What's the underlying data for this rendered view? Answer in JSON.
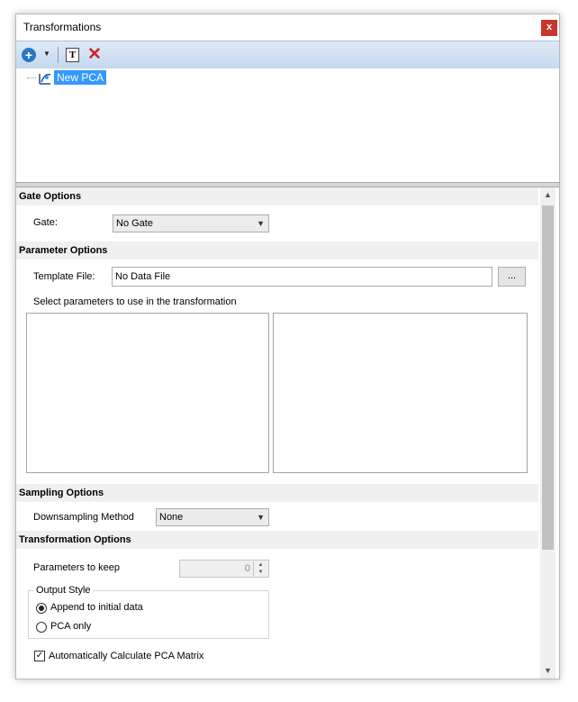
{
  "window": {
    "title": "Transformations",
    "close_label": "x"
  },
  "toolbar": {
    "add_icon": "plus-circle-icon",
    "text_icon_label": "T",
    "delete_icon": "red-x-icon"
  },
  "tree": {
    "node_label": "New PCA",
    "node_icon": "pca-icon"
  },
  "gate_options": {
    "header": "Gate Options",
    "gate_label": "Gate:",
    "gate_value": "No Gate"
  },
  "parameter_options": {
    "header": "Parameter Options",
    "template_label": "Template File:",
    "template_value": "No Data File",
    "browse_label": "...",
    "select_text": "Select parameters to use in the transformation"
  },
  "sampling_options": {
    "header": "Sampling Options",
    "method_label": "Downsampling Method",
    "method_value": "None"
  },
  "transformation_options": {
    "header": "Transformation Options",
    "params_keep_label": "Parameters to keep",
    "params_keep_value": "0",
    "output_style_label": "Output Style",
    "append_label": "Append to initial data",
    "pca_only_label": "PCA only",
    "auto_calc_label": "Automatically Calculate PCA Matrix"
  },
  "colors": {
    "selection": "#3399ff",
    "close": "#c8372d",
    "toolbar": "#c4d8ef"
  }
}
